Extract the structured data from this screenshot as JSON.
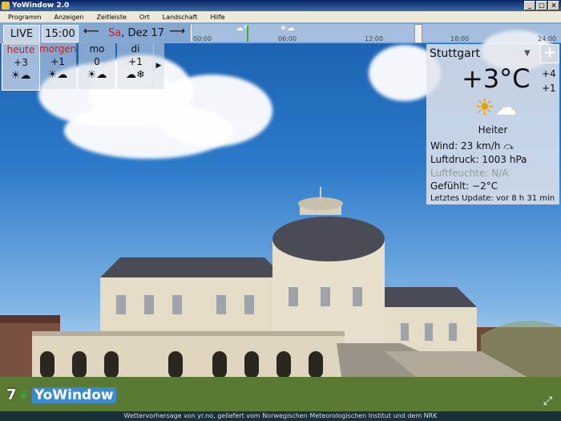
{
  "window": {
    "title": "YoWindow 2.0"
  },
  "menu": [
    "Programm",
    "Anzeigen",
    "Zeitleiste",
    "Ort",
    "Landschaft",
    "Hilfe"
  ],
  "toolbar": {
    "live": "LIVE",
    "time": "15:00",
    "prev": "⟵",
    "next": "⟶",
    "day_abbr": "Sa",
    "date": ", Dez 17"
  },
  "timeline": {
    "ticks": [
      "00:00",
      "06:00",
      "12:00",
      "18:00",
      "24:00"
    ]
  },
  "forecast": [
    {
      "name": "heute",
      "temp": "+3",
      "icon": "sun-cloud-icon",
      "highlight": true
    },
    {
      "name": "morgen",
      "temp": "+1",
      "icon": "sun-cloud-icon",
      "highlight": true
    },
    {
      "name": "mo",
      "temp": "0",
      "icon": "sun-cloud-icon",
      "highlight": false
    },
    {
      "name": "di",
      "temp": "+1",
      "icon": "snow-cloud-icon",
      "highlight": false
    }
  ],
  "forecast_more": "▶",
  "panel": {
    "city": "Stuttgart",
    "dropdown": "▼",
    "add": "+",
    "temp": "+3°C",
    "high": "+4",
    "low": "+1",
    "condition": "Heiter",
    "wind": "Wind:  23 km/h  ⤼",
    "pressure": "Luftdruck:  1003 hPa",
    "humidity": "Luftfeuchte:  N/A",
    "feels": "Gefühlt:  −2°C",
    "updated": "Letztes Update:  vor 8 h 31 min"
  },
  "logo": {
    "seven": "7",
    "yo": "Yo",
    "window": "Window"
  },
  "status": "Wettervorhersage von yr.no, geliefert vom Norwegischen Meteorologischen Institut und dem NRK",
  "colors": {
    "accent": "#c02020",
    "sky": "#2b79c9"
  }
}
